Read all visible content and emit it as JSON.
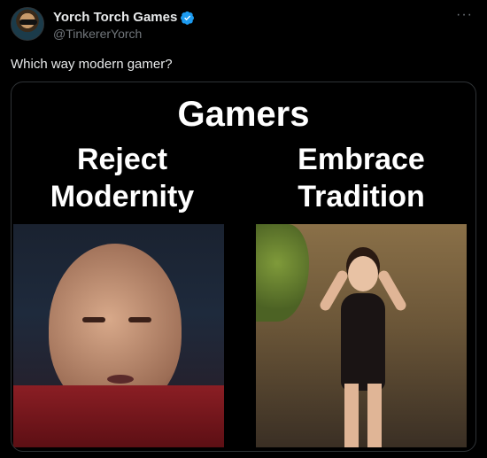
{
  "author": {
    "display_name": "Yorch Torch Games",
    "handle": "@TinkererYorch",
    "verified_icon": "verified-badge-icon",
    "verified_color": "#1d9bf0"
  },
  "more_label": "···",
  "tweet_text": "Which way modern gamer?",
  "meme": {
    "title": "Gamers",
    "left_label_line1": "Reject",
    "left_label_line2": "Modernity",
    "right_label_line1": "Embrace",
    "right_label_line2": "Tradition"
  }
}
